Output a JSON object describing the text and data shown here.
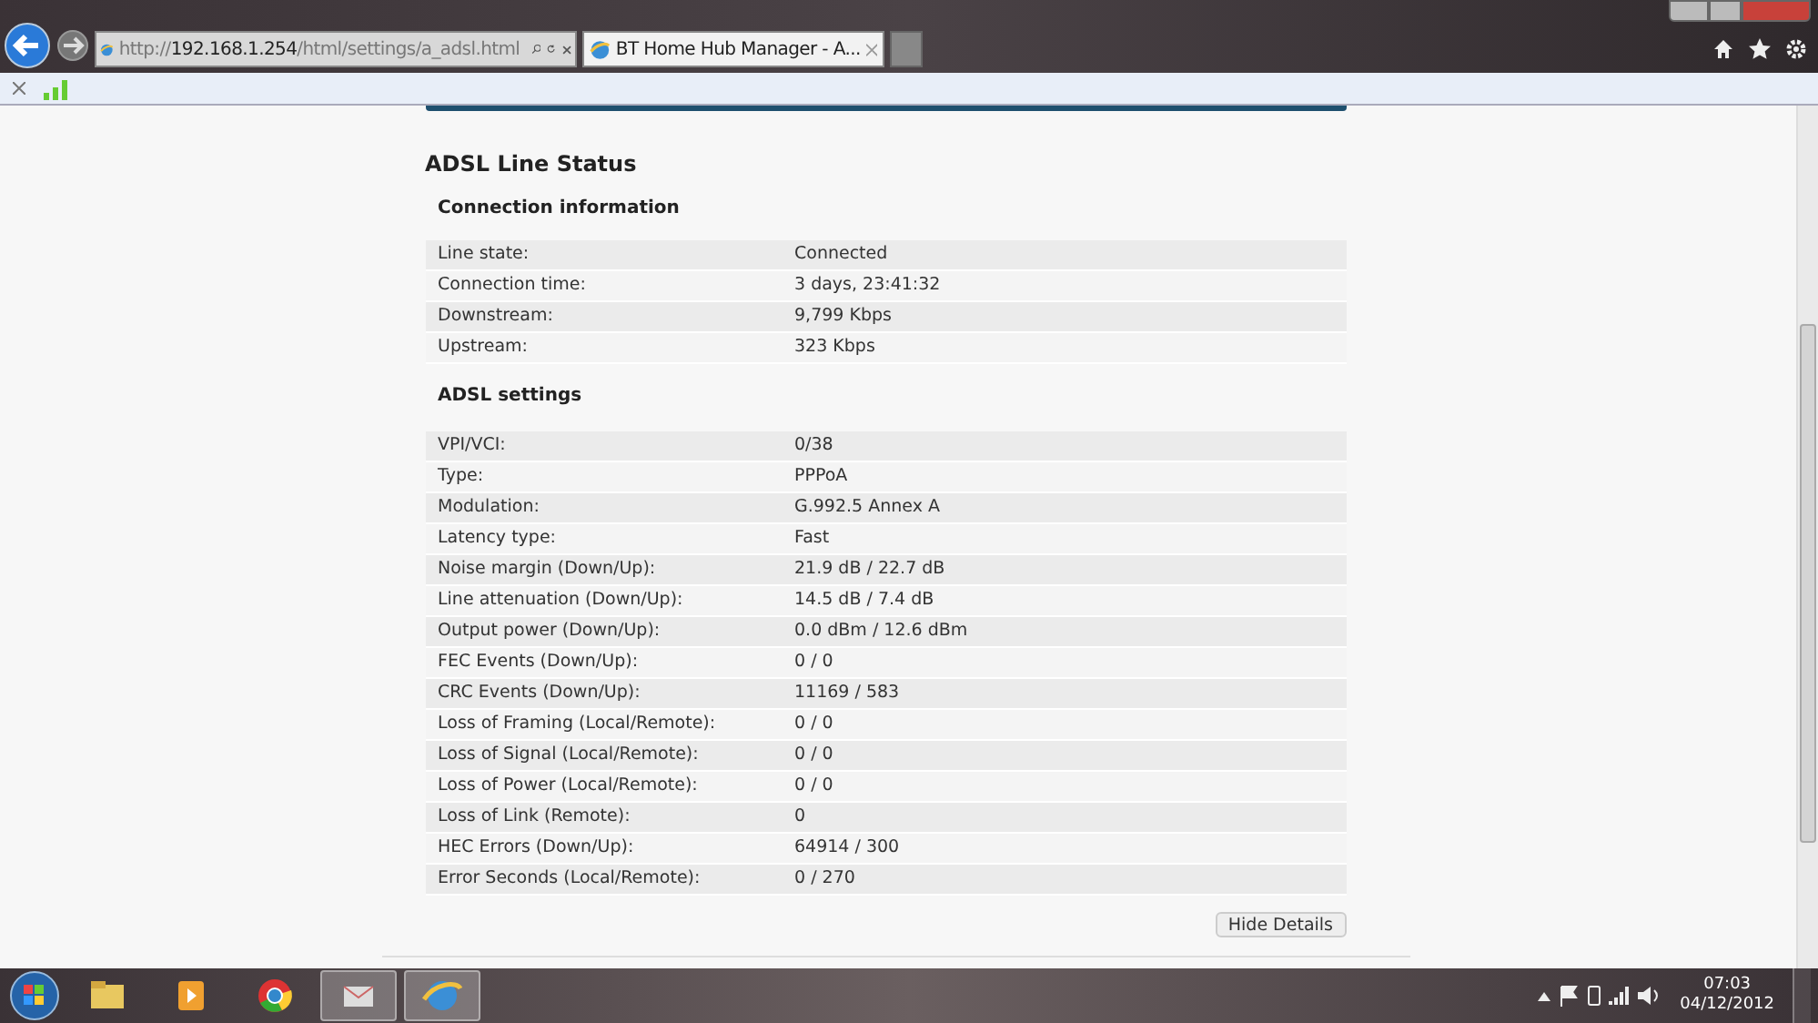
{
  "browser": {
    "address": "http://**192.168.1.254**/html/settings/a_adsl.html",
    "tabs": [
      {
        "label": "BT Home Hub Manager - A...",
        "selected": true
      }
    ]
  },
  "page": {
    "title": "ADSL Line Status",
    "sections": [
      {
        "heading": "Connection information",
        "rows": [
          {
            "label": "Line state:",
            "value": "Connected"
          },
          {
            "label": "Connection time:",
            "value": "3 days, 23:41:32"
          },
          {
            "label": "Downstream:",
            "value": "9,799 Kbps"
          },
          {
            "label": "Upstream:",
            "value": "323 Kbps"
          }
        ]
      },
      {
        "heading": "ADSL settings",
        "rows": [
          {
            "label": "VPI/VCI:",
            "value": "0/38"
          },
          {
            "label": "Type:",
            "value": "PPPoA"
          },
          {
            "label": "Modulation:",
            "value": "G.992.5 Annex A"
          },
          {
            "label": "Latency type:",
            "value": "Fast"
          },
          {
            "label": "Noise margin (Down/Up):",
            "value": "21.9 dB / 22.7 dB"
          },
          {
            "label": "Line attenuation (Down/Up):",
            "value": "14.5 dB / 7.4 dB"
          },
          {
            "label": "Output power (Down/Up):",
            "value": "0.0 dBm / 12.6 dBm"
          },
          {
            "label": "FEC Events (Down/Up):",
            "value": "0 / 0"
          },
          {
            "label": "CRC Events (Down/Up):",
            "value": "11169 / 583"
          },
          {
            "label": "Loss of Framing (Local/Remote):",
            "value": "0 / 0"
          },
          {
            "label": "Loss of Signal (Local/Remote):",
            "value": "0 / 0"
          },
          {
            "label": "Loss of Power (Local/Remote):",
            "value": "0 / 0"
          },
          {
            "label": "Loss of Link (Remote):",
            "value": "0"
          },
          {
            "label": "HEC Errors (Down/Up):",
            "value": "64914 / 300"
          },
          {
            "label": "Error Seconds (Local/Remote):",
            "value": "0 / 270"
          }
        ]
      }
    ],
    "button": "Hide Details"
  },
  "taskbar": {
    "items": [
      {
        "kind": "folder",
        "selected": false
      },
      {
        "kind": "media",
        "selected": false
      },
      {
        "kind": "chrome",
        "selected": false
      },
      {
        "kind": "mail",
        "selected": true
      },
      {
        "kind": "ie",
        "selected": true
      }
    ],
    "time": "07:03",
    "date": "04/12/2012"
  }
}
